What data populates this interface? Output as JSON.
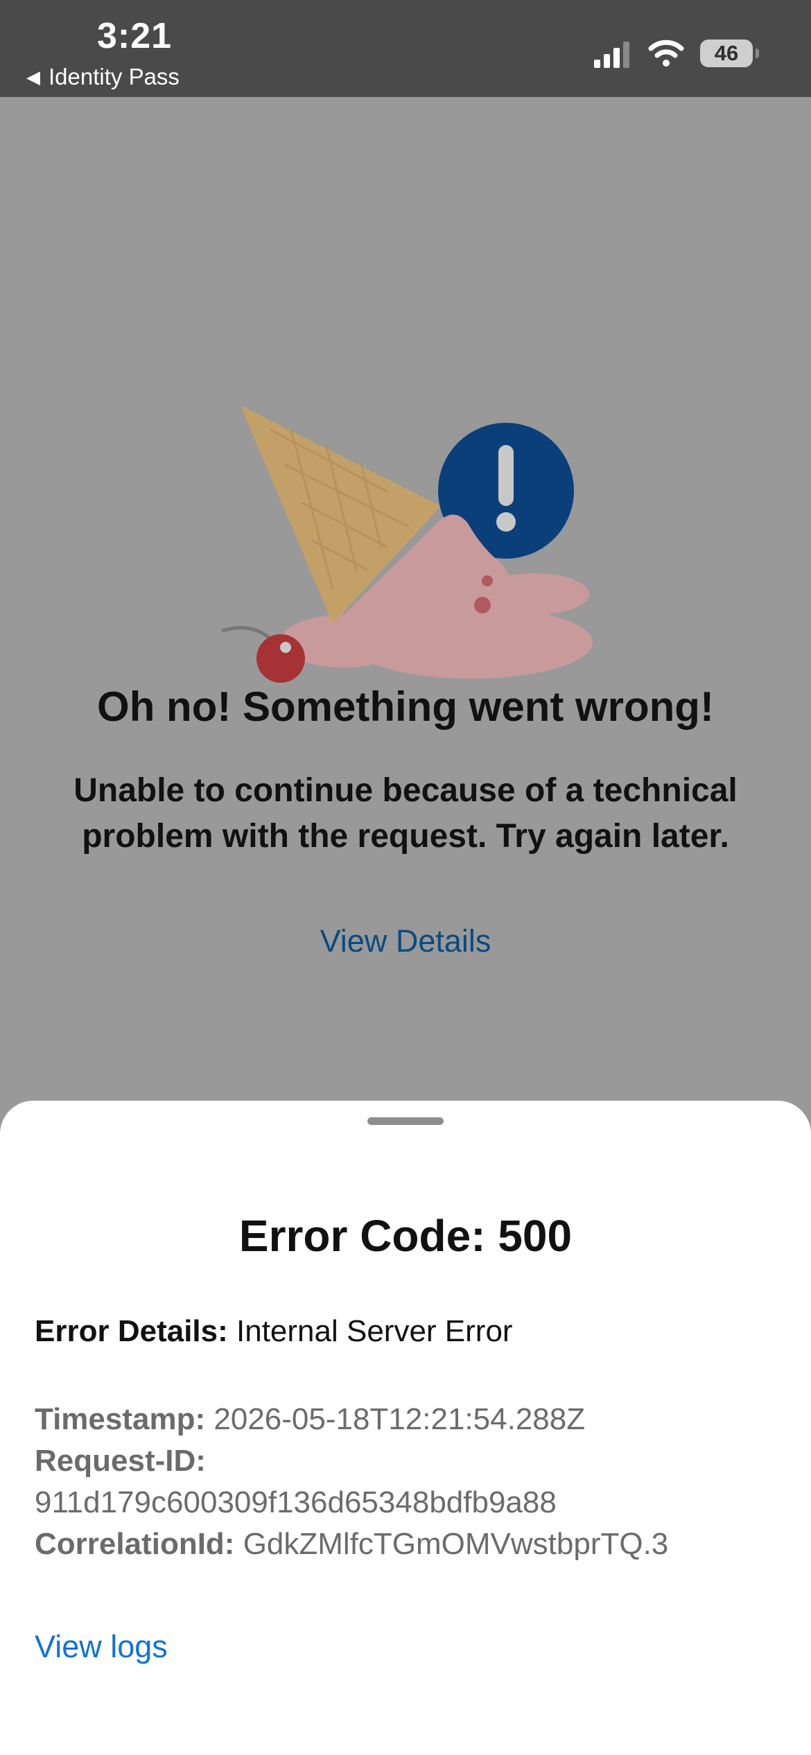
{
  "status_bar": {
    "time": "3:21",
    "back_app": "Identity Pass",
    "battery": "46",
    "icons": [
      "cellular-signal-icon",
      "wifi-icon",
      "battery-icon"
    ]
  },
  "error_page": {
    "illustration": "dropped-ice-cream-icon",
    "title": "Oh no! Something went wrong!",
    "message": "Unable to continue because of a technical problem with the request. Try again later.",
    "view_details": "View Details"
  },
  "sheet": {
    "error_code": "Error Code: 500",
    "details_label": "Error Details:",
    "details_value": "Internal Server Error",
    "timestamp_label": "Timestamp:",
    "timestamp_value": "2026-05-18T12:21:54.288Z",
    "request_id_label": "Request-ID:",
    "request_id_value": "911d179c600309f136d65348bdfb9a88",
    "correlation_label": "CorrelationId:",
    "correlation_value": "GdkZMlfcTGmOMVwstbprTQ.3",
    "view_logs": "View logs"
  },
  "colors": {
    "status_bar_bg": "#4a4a4a",
    "overlay_bg": "#999999",
    "link_dimmed": "#0a4b80",
    "link": "#1172d6",
    "alert_circle": "#0b3f7a"
  }
}
